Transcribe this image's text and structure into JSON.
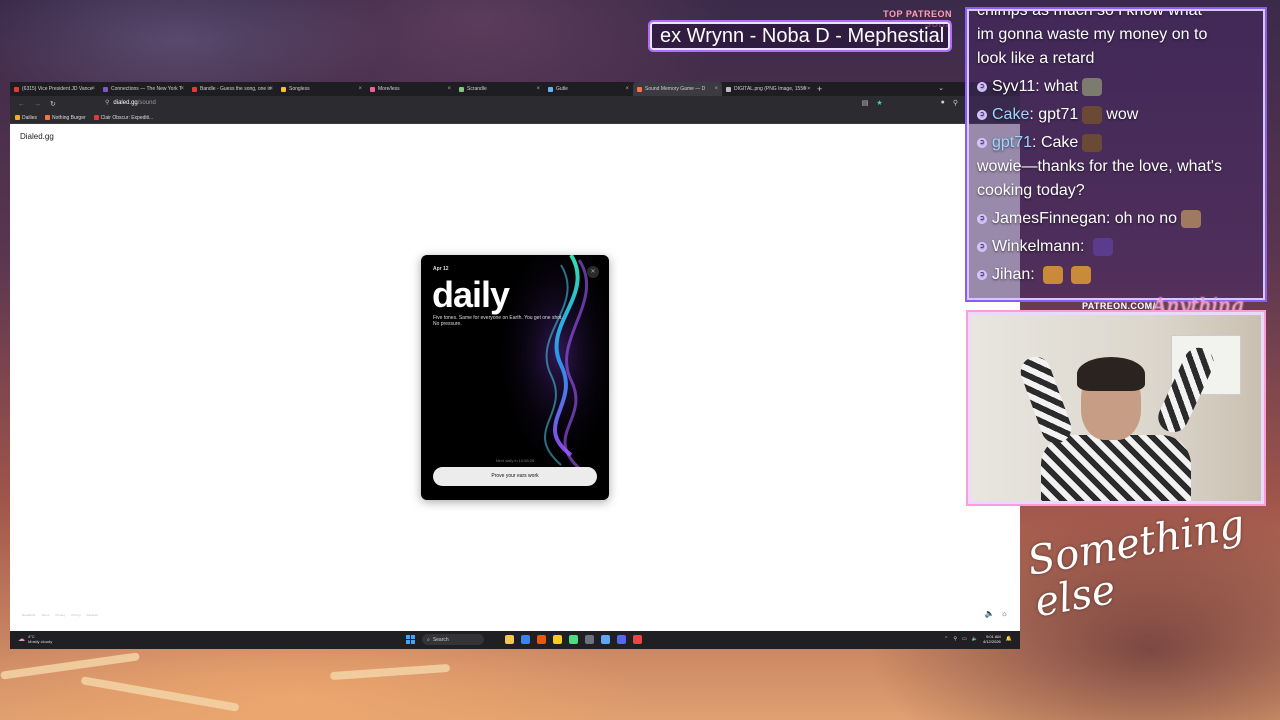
{
  "overlay": {
    "subs_label": "TOP PATREON SUBS",
    "subs_names": "ex Wrynn -  Noba D - Mephestial",
    "cam_label": "PATREON.COM/",
    "cam_script": "Anything else",
    "signature": "Something else"
  },
  "browser": {
    "tabs": [
      {
        "label": "(6315) Vice President JD Vance",
        "color": "#e53935"
      },
      {
        "label": "Connections — The New York T",
        "color": "#7e57c2"
      },
      {
        "label": "Bandle - Guess the song, one in",
        "color": "#e53935"
      },
      {
        "label": "Songless",
        "color": "#fbc02d"
      },
      {
        "label": "More/less",
        "color": "#f06292"
      },
      {
        "label": "Scrandle",
        "color": "#81c784"
      },
      {
        "label": "Gutle",
        "color": "#64b5f6"
      },
      {
        "label": "Sound Memory Game — D",
        "color": "#ff7043",
        "active": true
      },
      {
        "label": "DIGITAL.png (PNG Image, 1556 × 2",
        "color": "#bdbdbd"
      }
    ],
    "url_host": "dialed.gg",
    "url_path": "/sound",
    "bookmarks": [
      {
        "label": "Dailies",
        "color": "#f9a825"
      },
      {
        "label": "Nothing Burger",
        "color": "#ff7043"
      },
      {
        "label": "Clair Obscur: Expediti...",
        "color": "#e53935"
      }
    ]
  },
  "page": {
    "site_title": "Dialed.gg",
    "footer_links": [
      "Recall123",
      "Terms",
      "Privacy",
      "Pricing",
      "Reviews"
    ]
  },
  "card": {
    "date": "Apr 12",
    "title": "daily",
    "description": "Five tones. Same for everyone on Earth. You get one shot. No pressure.",
    "next": "Next daily in 10:56:28",
    "button": "Prove your ears work"
  },
  "taskbar": {
    "weather_temp": "4°C",
    "weather_desc": "Mostly cloudy",
    "search": "Search",
    "time": "9:01 AM",
    "date": "4/12/2026",
    "apps": [
      "#f2c94c",
      "#3b82f6",
      "#ea580c",
      "#facc15",
      "#4ade80",
      "#6b7280",
      "#60a5fa",
      "#5865f2",
      "#ef4444"
    ]
  },
  "chat": {
    "top_fragment": "chimps as much so i know what",
    "lines": [
      {
        "text": "im gonna waste my money on to"
      },
      {
        "text": "look like a retard"
      }
    ],
    "messages": [
      {
        "user": "Syv11",
        "text": "what",
        "emote": "stone"
      },
      {
        "user": "Cake",
        "text": "gpt71",
        "emote": "brown",
        "after": "wow",
        "blue": true
      },
      {
        "user": "gpt71",
        "text": "Cake",
        "emote": "brown",
        "after": "wowie—thanks for the love, what's cooking today?",
        "blue": true
      },
      {
        "user": "JamesFinnegan",
        "text": "oh no no",
        "emote": "face"
      },
      {
        "user": "Winkelmann",
        "text": "",
        "emote": "purple"
      },
      {
        "user": "Jihan",
        "text": "",
        "emote": "gold"
      }
    ]
  }
}
